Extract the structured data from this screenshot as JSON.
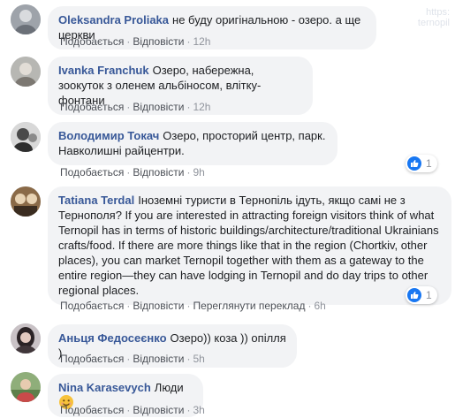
{
  "actions": {
    "like": "Подобається",
    "reply": "Відповісти",
    "see_translation": "Переглянути переклад",
    "sep": "·"
  },
  "comments": [
    {
      "name": "Oleksandra Proliaka",
      "text": "не буду оригінальною - озеро. а ще церкви",
      "time": "12h",
      "avatar": "avatar-gray"
    },
    {
      "name": "Ivanka Franchuk",
      "text": "Озеро, набережна, зоокуток з оленем альбіносом, влітку-фонтани",
      "time": "12h",
      "avatar": "avatar-gray"
    },
    {
      "name": "Володимир Токач",
      "text": "Озеро, просторий центр, парк. Навколишні райцентри.",
      "time": "9h",
      "avatar": "avatar-bw",
      "reactions": "1"
    },
    {
      "name": "Tatiana Terdal",
      "text": "Іноземні туристи в Тернопіль ідуть, якщо самі не з Тернополя? If you are interested in attracting foreign visitors think of what Ternopil has in terms of historic buildings/architecture/traditional Ukrainians crafts/food. If there are more things like that in the region (Chortkiv, other places), you can market Ternopil together with them as a gateway to the entire region—they can have lodging in Ternopil and do day trips to other regional places.",
      "time": "6h",
      "avatar": "avatar-brown",
      "reactions": "1"
    },
    {
      "name": "Аньця Федосеєнко",
      "text": "Озеро)) коза )) опілля )",
      "time": "5h",
      "avatar": "avatar-dark"
    },
    {
      "name": "Nina Karasevych",
      "text": "Люди",
      "time": "3h",
      "avatar": "avatar-outdoor",
      "emoji": "smiling-emoji-icon"
    }
  ],
  "watermark": {
    "line1": "https:",
    "line2": "ternopil"
  }
}
